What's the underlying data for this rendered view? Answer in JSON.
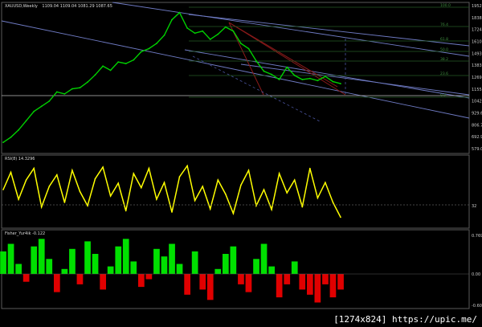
{
  "header": {
    "symbol_title": "XAUUSD,Weekly",
    "ohlc_text": "1109.04 1109.04 1081.29 1087.65"
  },
  "rsi_panel": {
    "title": "RSI(8) 14.3296",
    "level": "32"
  },
  "fisher_panel": {
    "title": "Fisher_Yur4ik -0.122"
  },
  "watermark": "[1274x824] https://upic.me/",
  "colors": {
    "price": "#00d000",
    "rsi": "#ffff00",
    "hist_pos": "#00e000",
    "hist_neg": "#e00000",
    "channel": "#7b86c8",
    "fan": "#8b1a1a",
    "fib": "#2e6b2e",
    "background": "#000000"
  },
  "chart_data": [
    {
      "type": "line",
      "name": "price",
      "price_axis_labels": [
        "1952.15",
        "1838.05",
        "1724.45",
        "1610.65",
        "1493.50",
        "1383.00",
        "1269.25",
        "1155.90",
        "1042.45",
        "929.60",
        "806.75",
        "692.90",
        "579.00"
      ],
      "fib_level_labels": [
        "100.0",
        "76.4",
        "61.8",
        "50.0",
        "38.2",
        "23.6",
        "0.0"
      ],
      "ylim": [
        579,
        1952
      ],
      "x": [
        0,
        10,
        20,
        30,
        40,
        50,
        60,
        70,
        80,
        90,
        100,
        110,
        120,
        130,
        140,
        150,
        160,
        170,
        180,
        190,
        200,
        210,
        220,
        230,
        240,
        250,
        260,
        270,
        280,
        290,
        300,
        310,
        320,
        330,
        340,
        350,
        360,
        370,
        380,
        390,
        400,
        410,
        420,
        430,
        440
      ],
      "values": [
        640,
        690,
        760,
        850,
        940,
        990,
        1040,
        1130,
        1110,
        1160,
        1170,
        1225,
        1295,
        1380,
        1340,
        1420,
        1405,
        1440,
        1520,
        1550,
        1600,
        1680,
        1830,
        1900,
        1750,
        1700,
        1720,
        1640,
        1690,
        1760,
        1720,
        1600,
        1550,
        1430,
        1330,
        1300,
        1250,
        1370,
        1290,
        1250,
        1260,
        1240,
        1280,
        1230,
        1210
      ]
    },
    {
      "type": "line",
      "name": "rsi",
      "level": 32,
      "x": [
        0,
        10,
        20,
        30,
        40,
        50,
        60,
        70,
        80,
        90,
        100,
        110,
        120,
        130,
        140,
        150,
        160,
        170,
        180,
        190,
        200,
        210,
        220,
        230,
        240,
        250,
        260,
        270,
        280,
        290,
        300,
        310,
        320,
        330,
        340,
        350,
        360,
        370,
        380,
        390,
        400,
        410,
        420,
        430,
        440
      ],
      "values": [
        55,
        82,
        40,
        70,
        88,
        28,
        60,
        78,
        35,
        85,
        52,
        30,
        72,
        90,
        45,
        65,
        22,
        80,
        58,
        88,
        40,
        66,
        20,
        75,
        92,
        38,
        60,
        25,
        70,
        48,
        18,
        62,
        85,
        30,
        55,
        24,
        80,
        50,
        70,
        28,
        88,
        42,
        66,
        35,
        12
      ]
    },
    {
      "type": "bar",
      "name": "fisher",
      "ylim": [
        -0.604,
        0.769
      ],
      "tick_labels": [
        "0.769",
        "0.00",
        "-0.604"
      ],
      "x": [
        0,
        10,
        20,
        30,
        40,
        50,
        60,
        70,
        80,
        90,
        100,
        110,
        120,
        130,
        140,
        150,
        160,
        170,
        180,
        190,
        200,
        210,
        220,
        230,
        240,
        250,
        260,
        270,
        280,
        290,
        300,
        310,
        320,
        330,
        340,
        350,
        360,
        370,
        380,
        390,
        400,
        410,
        420,
        430,
        440
      ],
      "values": [
        0.45,
        0.6,
        0.2,
        -0.15,
        0.55,
        0.7,
        0.3,
        -0.35,
        0.1,
        0.5,
        -0.2,
        0.65,
        0.4,
        -0.3,
        0.15,
        0.55,
        0.7,
        0.25,
        -0.25,
        -0.1,
        0.5,
        0.35,
        0.6,
        0.2,
        -0.4,
        0.45,
        -0.3,
        -0.5,
        0.1,
        0.4,
        0.55,
        -0.2,
        -0.35,
        0.3,
        0.6,
        0.15,
        -0.45,
        -0.2,
        0.25,
        -0.3,
        -0.4,
        -0.55,
        -0.2,
        -0.45,
        -0.3
      ]
    }
  ]
}
